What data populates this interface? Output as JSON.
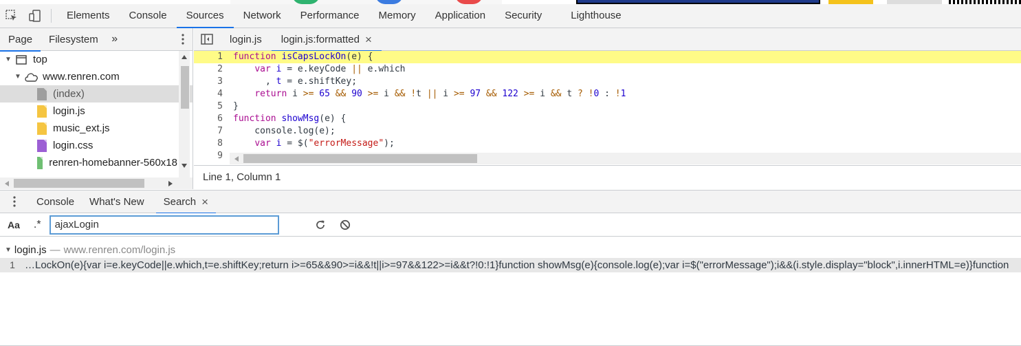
{
  "colors": {
    "accent": "#1a73e8",
    "highlight": "#fffb87",
    "toolbar_bg": "#f3f3f3"
  },
  "main_tabs": [
    "Elements",
    "Console",
    "Sources",
    "Network",
    "Performance",
    "Memory",
    "Application",
    "Security",
    "Lighthouse"
  ],
  "main_tabs_active": "Sources",
  "navigator": {
    "tabs": [
      "Page",
      "Filesystem"
    ],
    "more": "»",
    "tree": [
      {
        "label": "top",
        "icon": "frame-icon"
      },
      {
        "label": "www.renren.com",
        "icon": "cloud-icon"
      },
      {
        "label": "(index)",
        "icon": "document-icon",
        "color": "#9e9e9e"
      },
      {
        "label": "login.js",
        "icon": "script-file-icon",
        "color": "#f5c542"
      },
      {
        "label": "music_ext.js",
        "icon": "script-file-icon",
        "color": "#f5c542"
      },
      {
        "label": "login.css",
        "icon": "stylesheet-file-icon",
        "color": "#9c5fd4"
      },
      {
        "label": "renren-homebanner-560x18",
        "icon": "image-file-icon",
        "color": "#6fbf73"
      }
    ]
  },
  "editor": {
    "tabs": [
      "login.js",
      "login.js:formatted"
    ],
    "close": "×",
    "status": "Line 1, Column 1",
    "gutter": [
      "1",
      "2",
      "3",
      "4",
      "5",
      "6",
      "7",
      "8",
      "9"
    ]
  },
  "drawer": {
    "tabs": [
      "Console",
      "What's New",
      "Search"
    ],
    "close": "×",
    "case_button": "Aa",
    "regex_button": ".*",
    "search_value": "ajaxLogin"
  },
  "results": {
    "file": "login.js",
    "dash": "—",
    "path": "www.renren.com/login.js",
    "line_number": "1",
    "line_text": "…LockOn(e){var i=e.keyCode||e.which,t=e.shiftKey;return i>=65&&90>=i&&!t||i>=97&&122>=i&&t?!0:!1}function showMsg(e){console.log(e);var i=$(\"errorMessage\");i&&(i.style.display=\"block\",i.innerHTML=e)}function"
  }
}
